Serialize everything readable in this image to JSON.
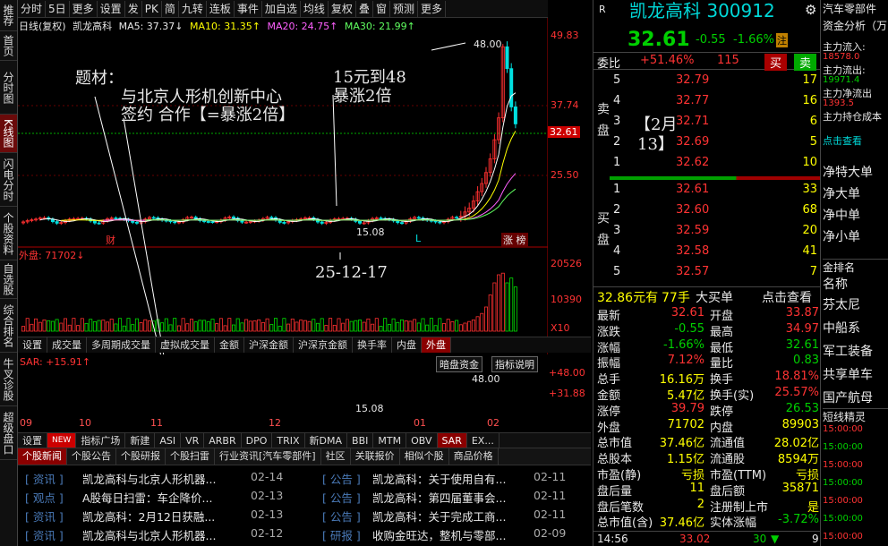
{
  "sidebar": [
    "推荐",
    "首页",
    "分时图",
    "K线图",
    "闪电分时",
    "个股资料",
    "自选股",
    "综合排名",
    "牛叉诊股",
    "超级盘口"
  ],
  "toolbar": [
    "分时",
    "5日",
    "更多",
    "设置",
    "发",
    "PK",
    "简",
    "九转",
    "连板",
    "事件",
    "加自选",
    "均线",
    "复权",
    "叠",
    "窗",
    "预测",
    "更多"
  ],
  "kline_info": {
    "title": "日线(复权)",
    "name": "凯龙高科",
    "ma5": "MA5: 37.37↓",
    "ma10": "MA10: 31.35↑",
    "ma20": "MA20: 24.75↑",
    "ma30": "MA30: 21.99↑"
  },
  "price_axis": [
    "49.83",
    "37.74",
    "32.61",
    "25.50"
  ],
  "kline_marks": {
    "high": "48.00",
    "low": "15.08",
    "tags": [
      "财",
      "L",
      "涨 榜"
    ]
  },
  "vol_label": "外盘: 71702↓",
  "vol_axis": [
    "20526",
    "10390",
    "X10"
  ],
  "sub_tabs": [
    "设置",
    "成交量",
    "多周期成交量",
    "虚拟成交量",
    "金额",
    "沪深金额",
    "沪深京金额",
    "换手率",
    "内盘",
    "外盘"
  ],
  "sar": {
    "label": "SAR: +15.91↑",
    "btn1": "暗盘资金",
    "btn2": "指标说明",
    "a1": "+48.00",
    "a2": "+31.88",
    "m1": "48.00",
    "m2": "15.08"
  },
  "date_axis": [
    "09",
    "10",
    "11",
    "12",
    "01",
    "02"
  ],
  "bottom_tabs": [
    "设置",
    "NEW",
    "指标广场",
    "新建",
    "ASI",
    "VR",
    "ARBR",
    "DPO",
    "TRIX",
    "新DMA",
    "BBI",
    "MTM",
    "OBV",
    "SAR",
    "EX..."
  ],
  "news_tabs": [
    "个股新闻",
    "个股公告",
    "个股研报",
    "个股扫雷",
    "行业资讯[汽车零部件]",
    "社区",
    "关联报价",
    "相似个股",
    "商品价格"
  ],
  "news": [
    {
      "t1": "[ 资讯 ]",
      "h1": "凯龙高科与北京人形机器...",
      "d1": "02-14",
      "t2": "[ 公告 ]",
      "h2": "凯龙高科：关于使用自有...",
      "d2": "02-11"
    },
    {
      "t1": "[ 观点 ]",
      "h1": "A股每日扫雷：车企降价...",
      "d1": "02-13",
      "t2": "[ 公告 ]",
      "h2": "凯龙高科：第四届董事会...",
      "d2": "02-11"
    },
    {
      "t1": "[ 资讯 ]",
      "h1": "凯龙高科：2月12日获融...",
      "d1": "02-13",
      "t2": "[ 公告 ]",
      "h2": "凯龙高科：关于完成工商...",
      "d2": "02-11"
    },
    {
      "t1": "[ 资讯 ]",
      "h1": "凯龙高科与北京人形机器...",
      "d1": "02-12",
      "t2": "[ 研报 ]",
      "h2": "收购金旺达，整机与零部...",
      "d2": "02-09"
    }
  ],
  "annotations": {
    "a1": "题材：",
    "a2": "与北京人形机创新中心",
    "a3": "签约 合作【=暴涨2倍】",
    "a4": "15元到48",
    "a5": "暴涨2倍",
    "a6": "25-12-17",
    "a7": "【2月",
    "a8": "13】"
  },
  "quote": {
    "r": "R",
    "name": "凯龙高科 300912",
    "price": "32.61",
    "chg": "-0.55",
    "pct": "-1.66%",
    "badge": "注",
    "wb_label": "委比",
    "wb": "+51.46%",
    "wc": "115",
    "buy": "买",
    "sell": "卖",
    "sell_side": "卖盘",
    "buy_side": "买盘",
    "asks": [
      [
        "5",
        "32.79",
        "17"
      ],
      [
        "4",
        "32.77",
        "16"
      ],
      [
        "3",
        "32.71",
        "6"
      ],
      [
        "2",
        "32.69",
        "5"
      ],
      [
        "1",
        "32.62",
        "10"
      ]
    ],
    "bids": [
      [
        "1",
        "32.61",
        "33"
      ],
      [
        "2",
        "32.60",
        "68"
      ],
      [
        "3",
        "32.59",
        "20"
      ],
      [
        "4",
        "32.58",
        "41"
      ],
      [
        "5",
        "32.57",
        "7"
      ]
    ],
    "bigorder": [
      "32.86元有",
      "77手",
      "大买单",
      "点击查看"
    ],
    "stats": [
      [
        "最新",
        "32.61",
        "开盘",
        "33.87"
      ],
      [
        "涨跌",
        "-0.55",
        "最高",
        "34.97"
      ],
      [
        "涨幅",
        "-1.66%",
        "最低",
        "32.61"
      ],
      [
        "振幅",
        "7.12%",
        "量比",
        "0.83"
      ],
      [
        "总手",
        "16.16万",
        "换手",
        "18.81%"
      ],
      [
        "金额",
        "5.47亿",
        "换手(实)",
        "25.57%"
      ],
      [
        "涨停",
        "39.79",
        "跌停",
        "26.53"
      ],
      [
        "外盘",
        "71702",
        "内盘",
        "89903"
      ],
      [
        "总市值",
        "37.46亿",
        "流通值",
        "28.02亿"
      ],
      [
        "总股本",
        "1.15亿",
        "流通股",
        "8594万"
      ],
      [
        "市盈(静)",
        "亏损",
        "市盈(TTM)",
        "亏损"
      ],
      [
        "盘后量",
        "11",
        "盘后额",
        "35871"
      ],
      [
        "盘后笔数",
        "2",
        "注册制上市",
        "是"
      ],
      [
        "总市值(含)",
        "37.46亿",
        "实体涨幅",
        "-3.72%"
      ]
    ],
    "last": [
      "14:56",
      "33.02",
      "30",
      "9"
    ]
  },
  "right": {
    "title": "汽车零部件",
    "sub": "资金分析（万",
    "flow": [
      [
        "主力流入:",
        "18578.0"
      ],
      [
        "主力流出:",
        "19971.4"
      ],
      [
        "主力净流出",
        "1393.5"
      ],
      [
        "主力持仓成本",
        ""
      ]
    ],
    "click": "点击查看",
    "items1": [
      "净特大单",
      "净大单",
      "净中单",
      "净小单"
    ],
    "rank": "金排名",
    "rank2": "名称",
    "items2": [
      "芬太尼",
      "中船系",
      "军工装备",
      "共享单车",
      "国产航母"
    ],
    "hot": "短线精灵",
    "times": [
      "15:00:00",
      "15:00:00",
      "15:00:00",
      "15:00:00",
      "15:00:00",
      "15:00:00",
      "15:00:00"
    ],
    "colors": {
      "up": "#ff3333",
      "down": "#00d000",
      "accent": "#ffff00"
    }
  }
}
